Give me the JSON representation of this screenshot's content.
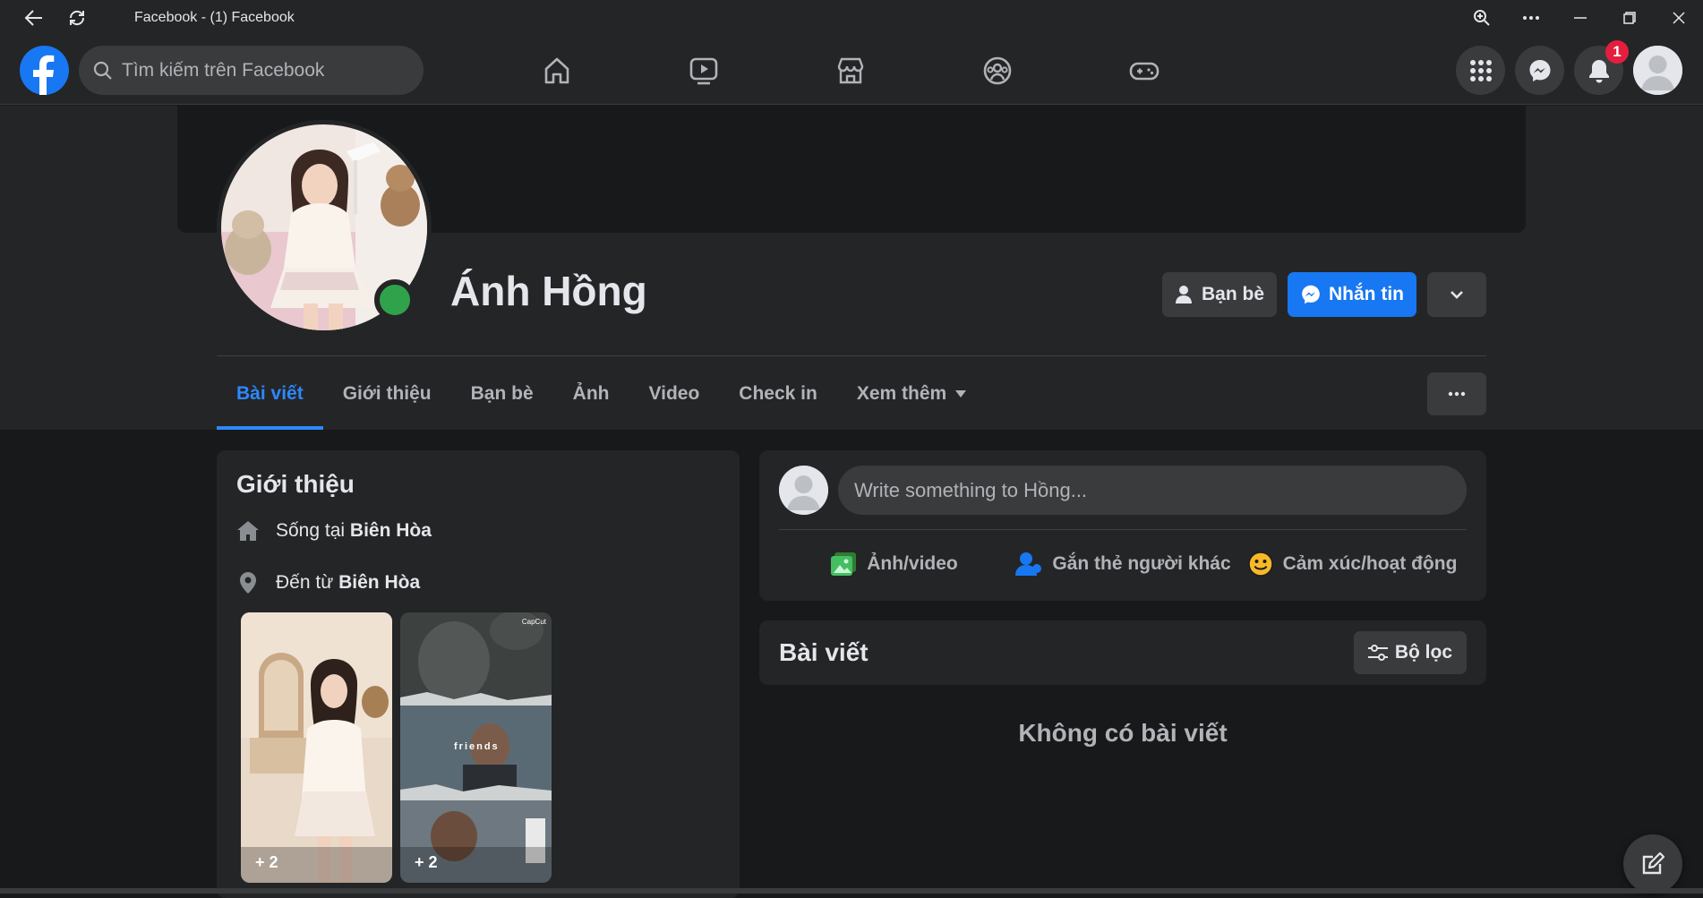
{
  "window": {
    "title": "Facebook - (1) Facebook"
  },
  "nav": {
    "search_placeholder": "Tìm kiếm trên Facebook",
    "tabs": [
      "home-icon",
      "watch-icon",
      "marketplace-icon",
      "groups-icon",
      "gaming-icon"
    ],
    "notification_count": "1",
    "accent": "#1877f2"
  },
  "profile": {
    "name": "Ánh Hồng",
    "friends_button": "Bạn bè",
    "message_button": "Nhắn tin",
    "online_color": "#31a24c",
    "tabs": [
      {
        "label": "Bài viết",
        "active": true
      },
      {
        "label": "Giới thiệu"
      },
      {
        "label": "Bạn bè"
      },
      {
        "label": "Ảnh"
      },
      {
        "label": "Video"
      },
      {
        "label": "Check in"
      },
      {
        "label": "Xem thêm"
      }
    ]
  },
  "intro": {
    "title": "Giới thiệu",
    "lives_prefix": "Sống tại",
    "lives_place": "Biên Hòa",
    "from_prefix": "Đến từ",
    "from_place": "Biên Hòa",
    "stories": [
      {
        "count": "+ 2"
      },
      {
        "count": "+ 2",
        "overlay": "friends",
        "watermark": "CapCut"
      }
    ]
  },
  "composer": {
    "placeholder": "Write something to Hồng...",
    "actions": [
      {
        "label": "Ảnh/video",
        "icon": "photo-video-icon"
      },
      {
        "label": "Gắn thẻ người khác",
        "icon": "tag-people-icon"
      },
      {
        "label": "Cảm xúc/hoạt động",
        "icon": "feeling-icon"
      }
    ]
  },
  "posts": {
    "title": "Bài viết",
    "filter_button": "Bộ lọc",
    "empty_text": "Không có bài viết"
  }
}
